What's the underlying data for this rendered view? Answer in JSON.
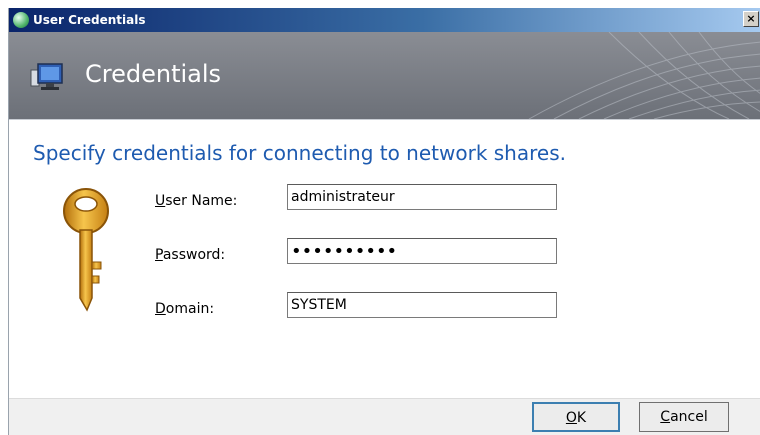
{
  "window": {
    "title": "User Credentials",
    "close_label": "×"
  },
  "banner": {
    "title": "Credentials"
  },
  "heading": "Specify credentials for connecting to network shares.",
  "fields": {
    "username": {
      "label_mnemonic": "U",
      "label_rest": "ser Name:",
      "value": "administrateur"
    },
    "password": {
      "label_mnemonic": "P",
      "label_rest": "assword:",
      "value": "••••••••••"
    },
    "domain": {
      "label_mnemonic": "D",
      "label_rest": "omain:",
      "value": "SYSTEM"
    }
  },
  "buttons": {
    "ok": {
      "mnemonic": "O",
      "rest": "K"
    },
    "cancel": {
      "mnemonic": "C",
      "rest": "ancel"
    }
  },
  "colors": {
    "heading": "#1e5bb0",
    "banner": "#6c7078",
    "titlebar_start": "#0a246a",
    "key": "#e2a21f"
  },
  "icons": {
    "title": "app-icon",
    "banner": "computer-monitor-icon",
    "key": "key-icon"
  }
}
